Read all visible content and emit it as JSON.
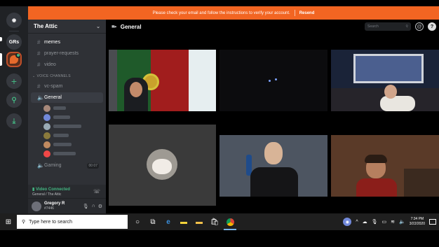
{
  "banner": {
    "message": "Please check your email and follow the instructions to verify your account.",
    "action": "Resend"
  },
  "servers": {
    "grs_label": "GRs"
  },
  "guild": {
    "name": "The Attic",
    "text_channels": [
      {
        "label": "memes",
        "active": true
      },
      {
        "label": "prayer-requests",
        "active": false
      },
      {
        "label": "video",
        "active": false
      }
    ],
    "voice_category": "VOICE CHANNELS",
    "voice_channels": [
      {
        "label": "vc-spam"
      },
      {
        "label": "General"
      }
    ],
    "gaming": {
      "label": "Gaming",
      "count": "00 07"
    }
  },
  "voice": {
    "status": "Video Connected",
    "location": "General / The Attic"
  },
  "user": {
    "name": "Gregory R",
    "tag": "#7446"
  },
  "main": {
    "channel_title": "General",
    "search_placeholder": "Search"
  },
  "taskbar": {
    "search_placeholder": "Type here to search",
    "time": "7:34 PM",
    "date": "3/22/2020"
  }
}
